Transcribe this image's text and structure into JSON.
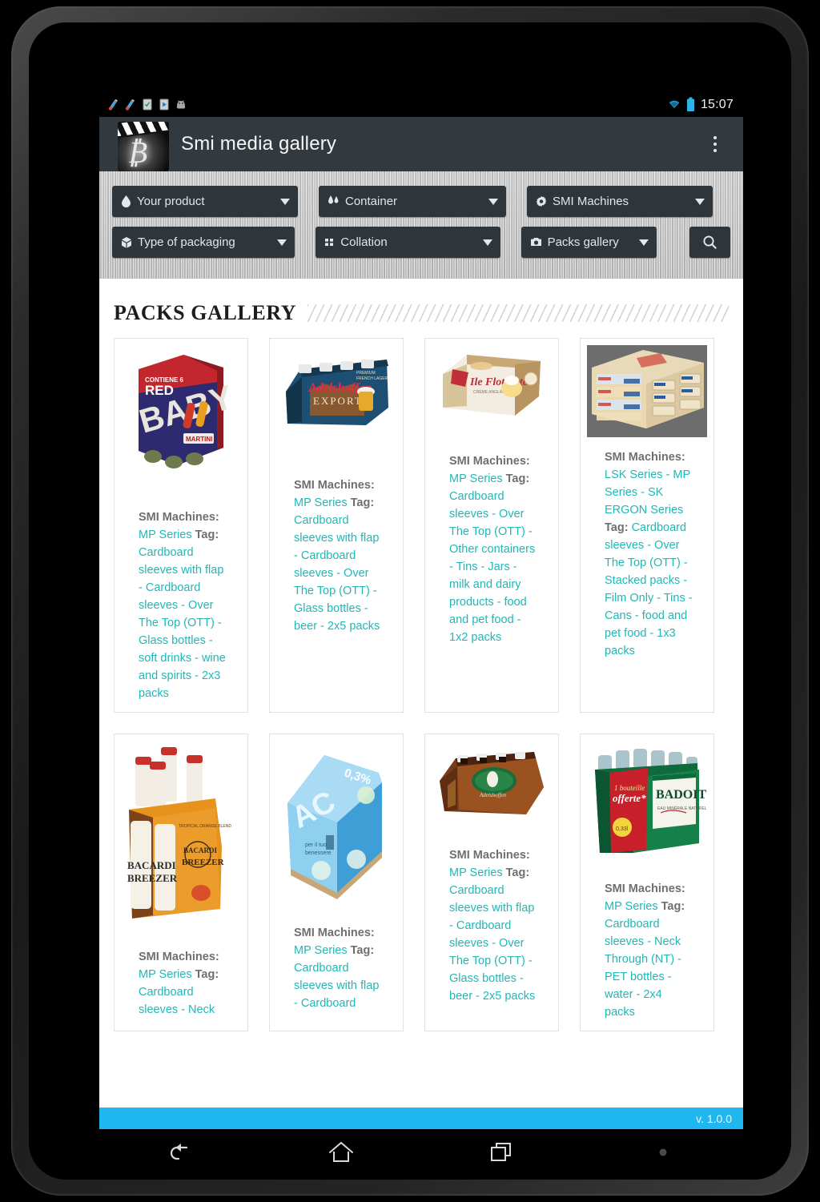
{
  "status_bar": {
    "time": "15:07",
    "icons": [
      "notification-icon",
      "notification-icon",
      "download-icon",
      "download-icon",
      "android-icon"
    ],
    "right_icons": [
      "wifi-icon",
      "battery-icon"
    ]
  },
  "app_bar": {
    "title": "Smi media gallery",
    "app_icon": "film-clapper-icon",
    "overflow_label": "overflow-menu"
  },
  "filters": {
    "row1": [
      {
        "label": "Your product",
        "icon": "droplet-icon"
      },
      {
        "label": "Container",
        "icon": "bottles-icon"
      },
      {
        "label": "SMI Machines",
        "icon": "gear-icon"
      }
    ],
    "row2": [
      {
        "label": "Type of packaging",
        "icon": "package-icon"
      },
      {
        "label": "Collation",
        "icon": "grid-icon"
      },
      {
        "label": "Packs gallery",
        "icon": "camera-icon"
      }
    ],
    "search_icon": "search-icon"
  },
  "page": {
    "title": "PACKS GALLERY"
  },
  "cards": [
    {
      "image": "baby-red-martini-6pack",
      "machines_label": "SMI Machines:",
      "machines": "MP Series",
      "tag_label": "Tag:",
      "tag": "Cardboard sleeves with flap - Cardboard sleeves - Over The Top (OTT) - Glass bottles - soft drinks - wine and spirits - 2x3 packs"
    },
    {
      "image": "fischer-adelshoffen-export-beer-10pack",
      "machines_label": "SMI Machines:",
      "machines": "MP Series",
      "tag_label": "Tag:",
      "tag": "Cardboard sleeves with flap - Cardboard sleeves - Over The Top (OTT) - Glass bottles - beer - 2x5 packs"
    },
    {
      "image": "angelo-ile-flottante-dessert-2pack",
      "machines_label": "SMI Machines:",
      "machines": "MP Series",
      "tag_label": "Tag:",
      "tag": "Cardboard sleeves - Over The Top (OTT) - Other containers - Tins - Jars - milk and dairy products - food and pet food - 1x2 packs"
    },
    {
      "image": "stacked-tins-pallet",
      "machines_label": "SMI Machines:",
      "machines": "LSK Series - MP Series - SK ERGON Series",
      "tag_label": "Tag:",
      "tag": "Cardboard sleeves - Over The Top (OTT) - Stacked packs - Film Only - Tins - Cans - food and pet food - 1x3 packs"
    },
    {
      "image": "bacardi-breezer-4pack",
      "machines_label": "SMI Machines:",
      "machines": "MP Series",
      "tag_label": "Tag:",
      "tag": "Cardboard sleeves - Neck"
    },
    {
      "image": "ac-water-6pack",
      "machines_label": "SMI Machines:",
      "machines": "MP Series",
      "tag_label": "Tag:",
      "tag": "Cardboard sleeves with flap - Cardboard"
    },
    {
      "image": "adelshoffen-beer-10pack",
      "machines_label": "SMI Machines:",
      "machines": "MP Series",
      "tag_label": "Tag:",
      "tag": "Cardboard sleeves with flap - Cardboard sleeves - Over The Top (OTT) - Glass bottles - beer - 2x5 packs"
    },
    {
      "image": "badoit-water-6pack",
      "machines_label": "SMI Machines:",
      "machines": "MP Series",
      "tag_label": "Tag:",
      "tag": "Cardboard sleeves - Neck Through (NT) - PET bottles - water - 2x4 packs"
    }
  ],
  "footer": {
    "version": "v. 1.0.0"
  },
  "nav_bar": {
    "buttons": [
      "back-icon",
      "home-icon",
      "recents-icon",
      "menu-dot-icon"
    ]
  },
  "colors": {
    "accent": "#20b6f0",
    "teal": "#23b6b6",
    "appbar": "#323a40",
    "select": "#2e363c"
  }
}
